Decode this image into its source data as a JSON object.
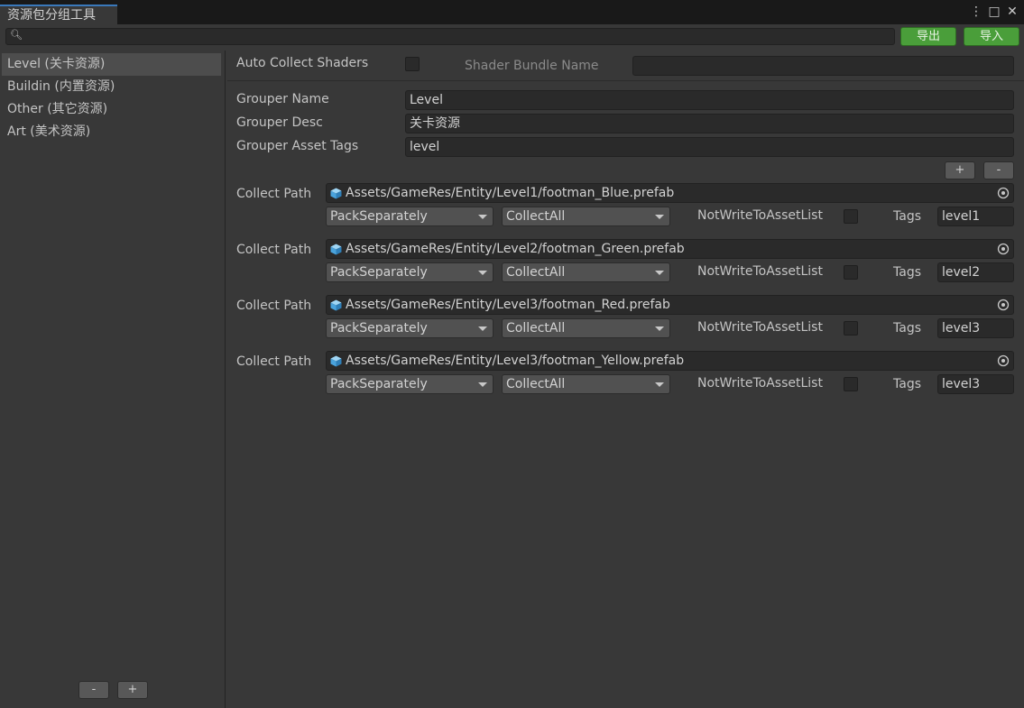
{
  "window": {
    "tab_title": "资源包分组工具",
    "controls": {
      "menu": "⋮",
      "maximize": "□",
      "close": "✕"
    }
  },
  "toolbar": {
    "search_value": "",
    "export_label": "导出",
    "import_label": "导入",
    "accent_green": "#4a9e3a"
  },
  "sidebar": {
    "items": [
      {
        "label": "Level (关卡资源)",
        "selected": true
      },
      {
        "label": "Buildin (内置资源)",
        "selected": false
      },
      {
        "label": "Other (其它资源)",
        "selected": false
      },
      {
        "label": "Art (美术资源)",
        "selected": false
      }
    ],
    "remove_label": "-",
    "add_label": "+"
  },
  "settings": {
    "auto_collect_label": "Auto Collect Shaders",
    "auto_collect_checked": false,
    "shader_bundle_label": "Shader Bundle Name",
    "shader_bundle_value": ""
  },
  "grouper": {
    "name_label": "Grouper Name",
    "name_value": "Level",
    "desc_label": "Grouper Desc",
    "desc_value": "关卡资源",
    "tags_label": "Grouper Asset Tags",
    "tags_value": "level",
    "add_label": "+",
    "remove_label": "-"
  },
  "collectors": [
    {
      "label": "Collect Path",
      "path": "Assets/GameRes/Entity/Level1/footman_Blue.prefab",
      "pack_rule": "PackSeparately",
      "filter_rule": "CollectAll",
      "nwtal_label": "NotWriteToAssetList",
      "nwtal_checked": false,
      "tags_label": "Tags",
      "tags_value": "level1"
    },
    {
      "label": "Collect Path",
      "path": "Assets/GameRes/Entity/Level2/footman_Green.prefab",
      "pack_rule": "PackSeparately",
      "filter_rule": "CollectAll",
      "nwtal_label": "NotWriteToAssetList",
      "nwtal_checked": false,
      "tags_label": "Tags",
      "tags_value": "level2"
    },
    {
      "label": "Collect Path",
      "path": "Assets/GameRes/Entity/Level3/footman_Red.prefab",
      "pack_rule": "PackSeparately",
      "filter_rule": "CollectAll",
      "nwtal_label": "NotWriteToAssetList",
      "nwtal_checked": false,
      "tags_label": "Tags",
      "tags_value": "level3"
    },
    {
      "label": "Collect Path",
      "path": "Assets/GameRes/Entity/Level3/footman_Yellow.prefab",
      "pack_rule": "PackSeparately",
      "filter_rule": "CollectAll",
      "nwtal_label": "NotWriteToAssetList",
      "nwtal_checked": false,
      "tags_label": "Tags",
      "tags_value": "level3"
    }
  ]
}
